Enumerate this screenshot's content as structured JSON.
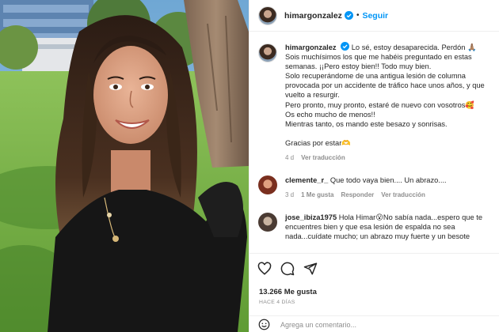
{
  "post": {
    "username": "himargonzalez",
    "follow_label": "Seguir",
    "dot": "•"
  },
  "caption": {
    "username": "himargonzalez",
    "lines": [
      "Lo sé, estoy desaparecida. Perdón 🙏🏽",
      "Sois muchísimos los que me habéis preguntado en estas",
      "semanas. ¡¡Pero estoy bien!! Todo muy bien.",
      "Solo recuperándome de una antigua lesión de columna",
      "provocada por un accidente de tráfico hace unos años, y que",
      "vuelto a resurgir.",
      "Pero pronto, muy pronto, estaré de nuevo con vosotros🥰",
      "Os echo mucho de menos!!",
      "Mientras tanto, os mando este besazo y sonrisas."
    ],
    "closing": "Gracias por estar🫶",
    "time": "4 d",
    "translate": "Ver traducción"
  },
  "comments": [
    {
      "username": "clemente_r_",
      "text": "Que todo vaya bien.... Un abrazo....",
      "time": "3 d",
      "likes": "1 Me gusta",
      "reply": "Responder",
      "translate": "Ver traducción"
    },
    {
      "username": "jose_ibiza1975",
      "lines": [
        "Hola Himar😮No sabía nada...espero que te",
        "encuentres bien y que esa lesión de espalda no sea",
        "nada...cuídate mucho; un abrazo muy fuerte y un besote"
      ]
    }
  ],
  "stats": {
    "likes": "13.266 Me gusta",
    "ago": "HACE 4 DÍAS"
  },
  "add_comment": {
    "placeholder": "Agrega un comentario..."
  },
  "icons": [
    "heart-icon",
    "comment-icon",
    "share-icon",
    "emoji-icon",
    "verified-icon"
  ],
  "colors": {
    "accent": "#0095f6",
    "muted": "#8e8e8e",
    "text": "#262626"
  }
}
